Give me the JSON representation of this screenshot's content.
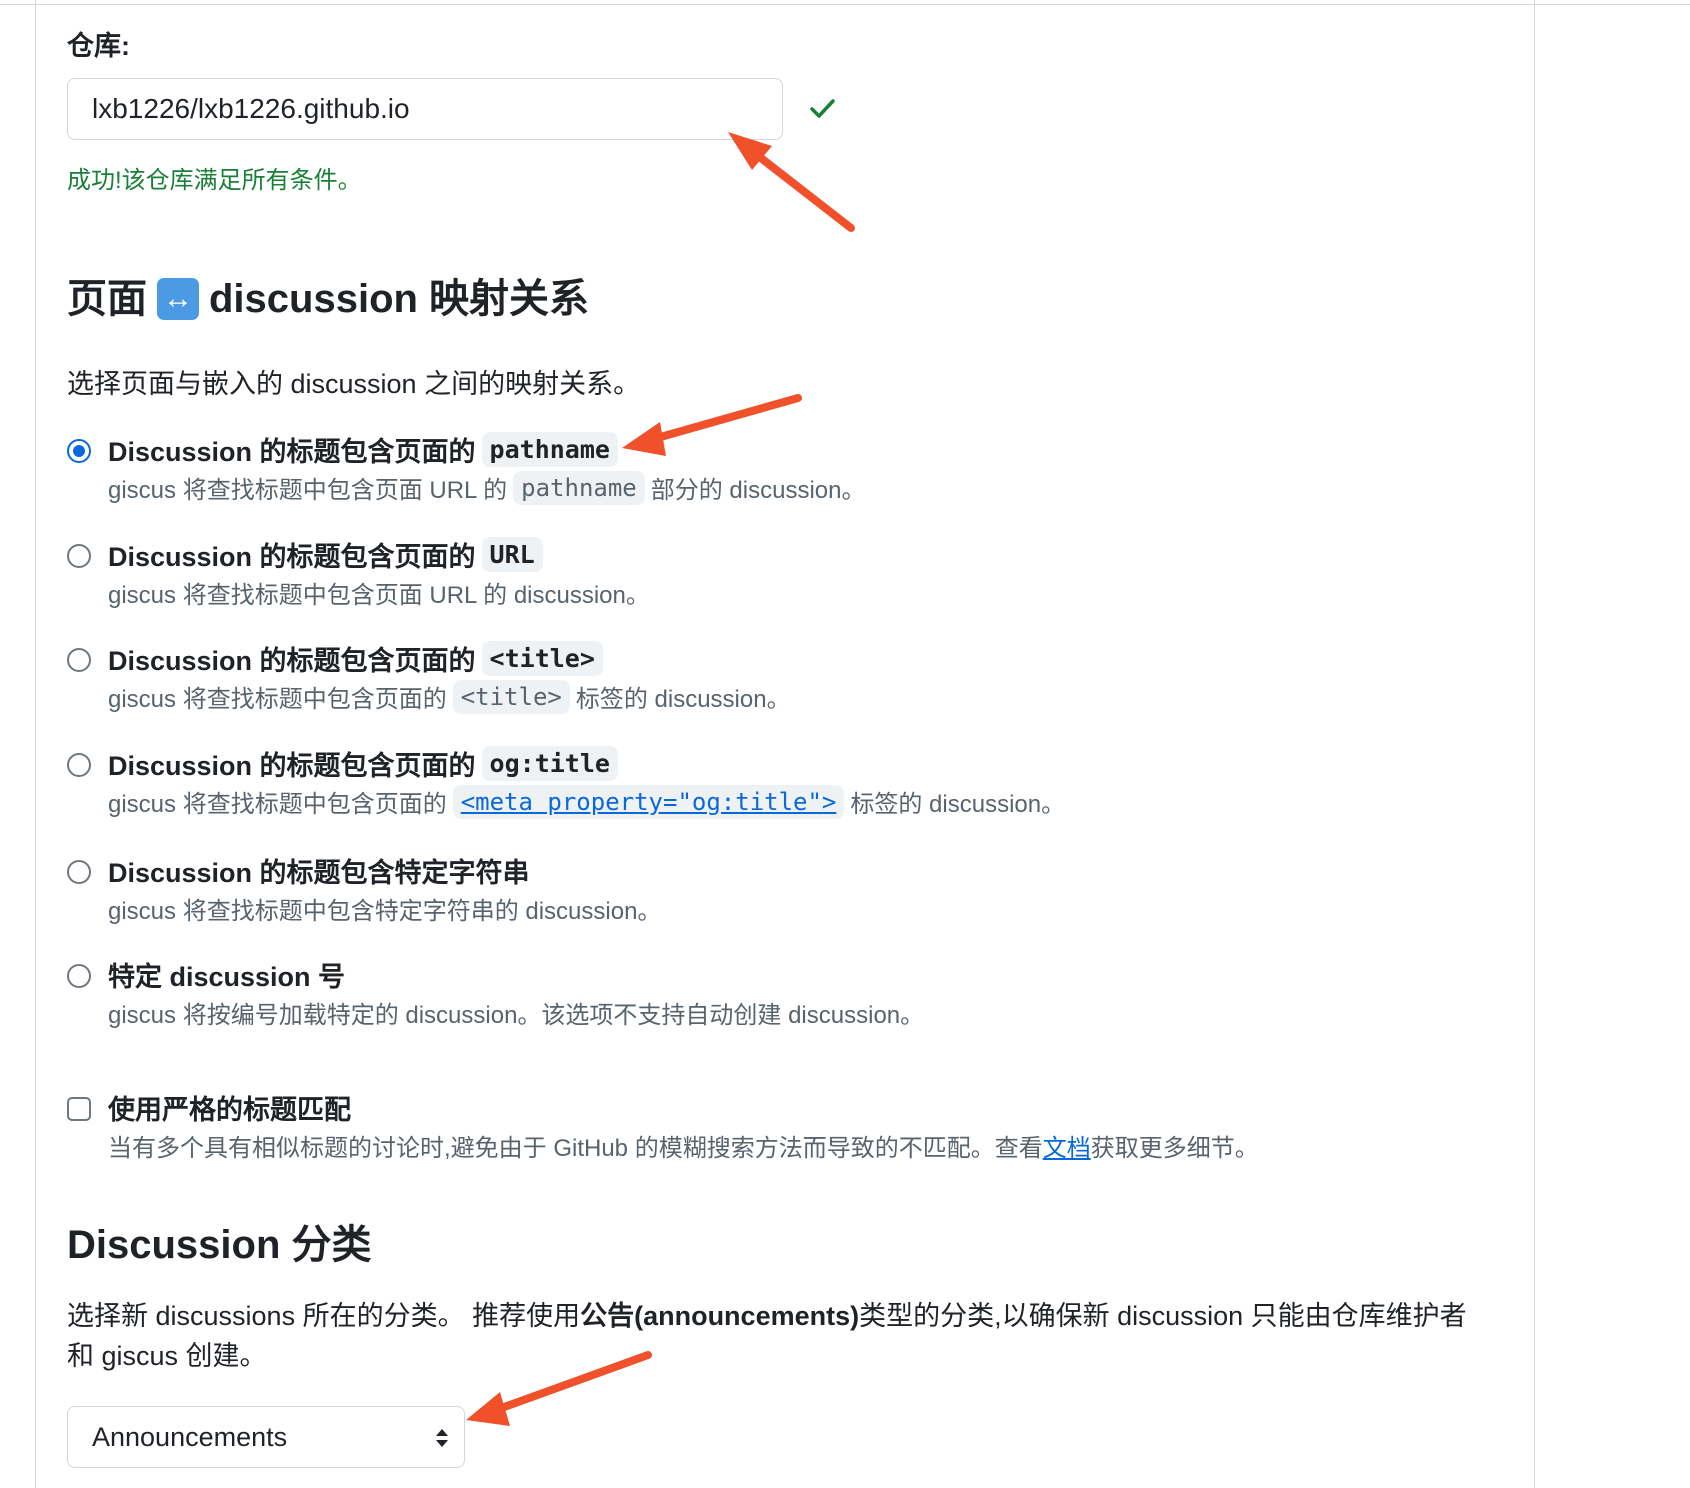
{
  "repository": {
    "label": "仓库:",
    "value": "lxb1226/lxb1226.github.io",
    "success_message": "成功!该仓库满足所有条件。"
  },
  "mapping": {
    "title_left": "页面",
    "title_emoji": "↔",
    "title_right": "discussion 映射关系",
    "description": "选择页面与嵌入的 discussion 之间的映射关系。",
    "options": [
      {
        "title_text": "Discussion 的标题包含页面的",
        "title_code": "pathname",
        "desc_pre": "giscus 将查找标题中包含页面 URL 的",
        "desc_code": "pathname",
        "desc_post": "部分的 discussion。",
        "selected": true
      },
      {
        "title_text": "Discussion 的标题包含页面的",
        "title_code": "URL",
        "desc_pre": "giscus 将查找标题中包含页面 URL 的 discussion。",
        "selected": false
      },
      {
        "title_text": "Discussion 的标题包含页面的",
        "title_code": "<title>",
        "desc_pre": "giscus 将查找标题中包含页面的",
        "desc_code": "<title>",
        "desc_post": "标签的 discussion。",
        "selected": false
      },
      {
        "title_text": "Discussion 的标题包含页面的",
        "title_code": "og:title",
        "desc_pre": "giscus 将查找标题中包含页面的",
        "desc_link": "<meta property=\"og:title\">",
        "desc_post": "标签的 discussion。",
        "selected": false
      },
      {
        "title_text": "Discussion 的标题包含特定字符串",
        "desc_pre": "giscus 将查找标题中包含特定字符串的 discussion。",
        "selected": false
      },
      {
        "title_text": "特定 discussion 号",
        "desc_pre": "giscus 将按编号加载特定的 discussion。该选项不支持自动创建 discussion。",
        "selected": false
      }
    ],
    "strict": {
      "label": "使用严格的标题匹配",
      "desc_pre": "当有多个具有相似标题的讨论时,避免由于 GitHub 的模糊搜索方法而导致的不匹配。查看",
      "desc_link": "文档",
      "desc_post": "获取更多细节。",
      "checked": false
    }
  },
  "category": {
    "title": "Discussion 分类",
    "desc_pre": "选择新 discussions 所在的分类。 推荐使用",
    "desc_bold": "公告(announcements)",
    "desc_post": "类型的分类,以确保新 discussion 只能由仓库维护者和 giscus 创建。",
    "selected": "Announcements"
  },
  "colors": {
    "success": "#1a7f37",
    "accent": "#0969da",
    "annotation_arrow": "#f0502a"
  }
}
